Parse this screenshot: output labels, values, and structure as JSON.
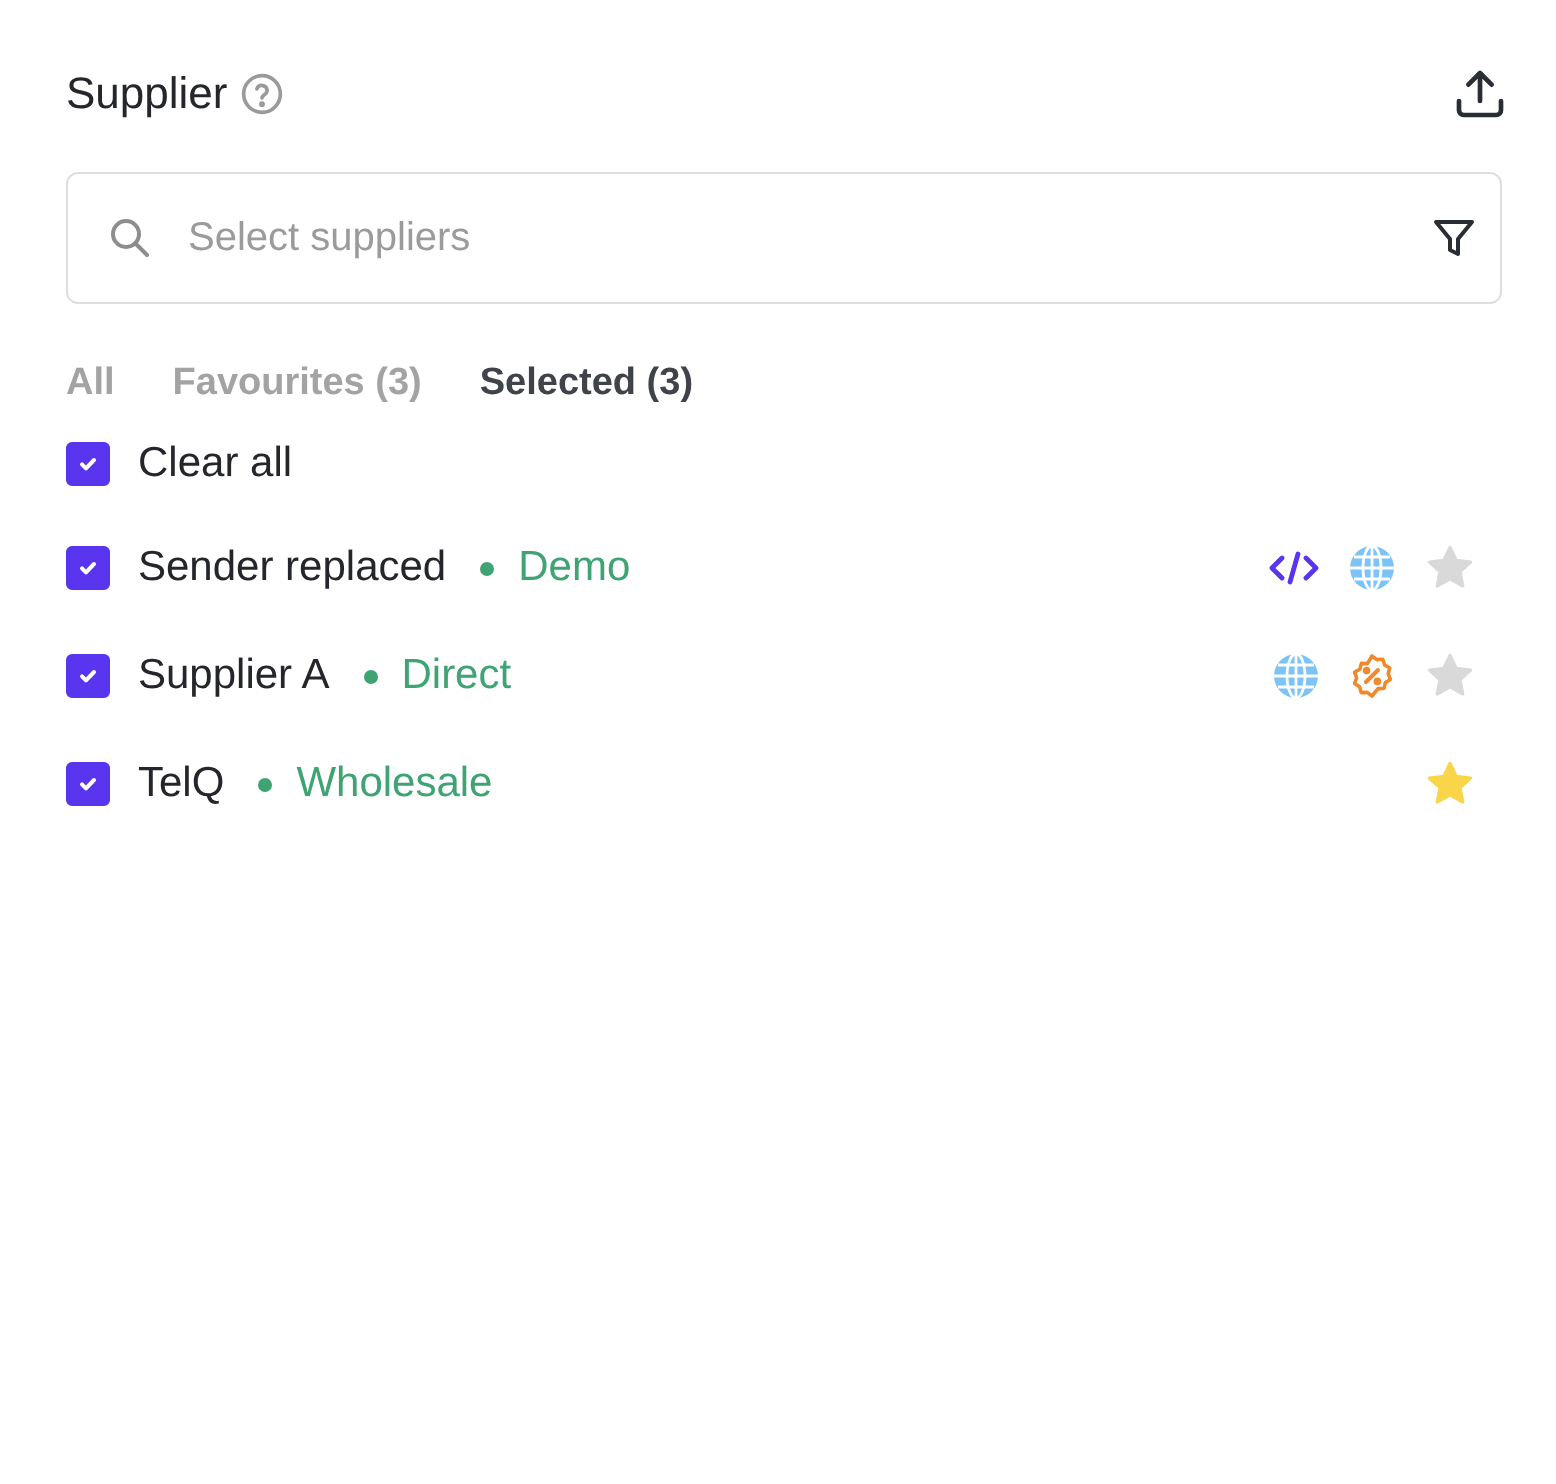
{
  "header": {
    "title": "Supplier"
  },
  "search": {
    "placeholder": "Select suppliers"
  },
  "tabs": [
    {
      "label": "All",
      "selected": false
    },
    {
      "label": "Favourites (3)",
      "selected": false
    },
    {
      "label": "Selected (3)",
      "selected": true
    }
  ],
  "clear_all": {
    "label": "Clear all",
    "checked": true
  },
  "suppliers": [
    {
      "name": "Sender replaced",
      "type": "Demo",
      "checked": true,
      "badges": [
        {
          "kind": "code"
        },
        {
          "kind": "globe"
        }
      ],
      "favourite": false
    },
    {
      "name": "Supplier A",
      "type": "Direct",
      "checked": true,
      "badges": [
        {
          "kind": "globe"
        },
        {
          "kind": "discount"
        }
      ],
      "favourite": false
    },
    {
      "name": "TelQ",
      "type": "Wholesale",
      "checked": true,
      "favourite": true
    }
  ]
}
